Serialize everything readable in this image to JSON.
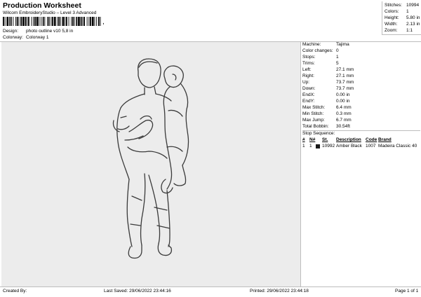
{
  "header": {
    "title": "Production Worksheet",
    "subtitle": "Wilcom EmbroideryStudio – Level 3 Advanced",
    "barcode_sep": ","
  },
  "design": {
    "label": "Design:",
    "value": "photo outline v10 5,8 in"
  },
  "colorway": {
    "label": "Colorway:",
    "value": "Colorway 1"
  },
  "stats": [
    {
      "label": "Stitches:",
      "value": "10994"
    },
    {
      "label": "Colors:",
      "value": "1"
    },
    {
      "label": "Height:",
      "value": "5.80 in"
    },
    {
      "label": "Width:",
      "value": "2.13 in"
    },
    {
      "label": "Zoom:",
      "value": "1:1"
    }
  ],
  "details": [
    {
      "label": "Machine:",
      "value": "Tajima"
    },
    {
      "label": "Color changes:",
      "value": "0"
    },
    {
      "label": "Stops:",
      "value": "1"
    },
    {
      "label": "Trims:",
      "value": "5"
    },
    {
      "label": "Left:",
      "value": "27.1 mm"
    },
    {
      "label": "Right:",
      "value": "27.1 mm"
    },
    {
      "label": "Up:",
      "value": "73.7 mm"
    },
    {
      "label": "Down:",
      "value": "73.7 mm"
    },
    {
      "label": "EndX:",
      "value": "0.00 in"
    },
    {
      "label": "EndY:",
      "value": "0.00 in"
    },
    {
      "label": "Max Stitch:",
      "value": "6.4 mm"
    },
    {
      "label": "Min Stitch:",
      "value": "0.3 mm"
    },
    {
      "label": "Max Jump:",
      "value": "6.7 mm"
    },
    {
      "label": "Total Bobbin:",
      "value": "30.54ft"
    }
  ],
  "stop_sequence": {
    "title": "Stop Sequence:",
    "headers": [
      "#",
      "N#",
      "St.",
      "Description",
      "Code",
      "Brand"
    ],
    "rows": [
      {
        "num": "1",
        "n": "1",
        "stitches": "10992",
        "description": "Amber Black",
        "code": "1007",
        "brand": "Madeira Classic 40",
        "swatch_color": "#1a1a1a"
      }
    ]
  },
  "footer": {
    "created": "Created By:",
    "last_saved": "Last Saved: 29/06/2022 23:44:16",
    "printed": "Printed: 29/06/2022 23:44:18",
    "page": "Page 1 of 1"
  },
  "colors": {
    "canvas_bg": "#ececec",
    "stitch_line": "#3a3a3a",
    "rule": "#bdbdbd"
  }
}
